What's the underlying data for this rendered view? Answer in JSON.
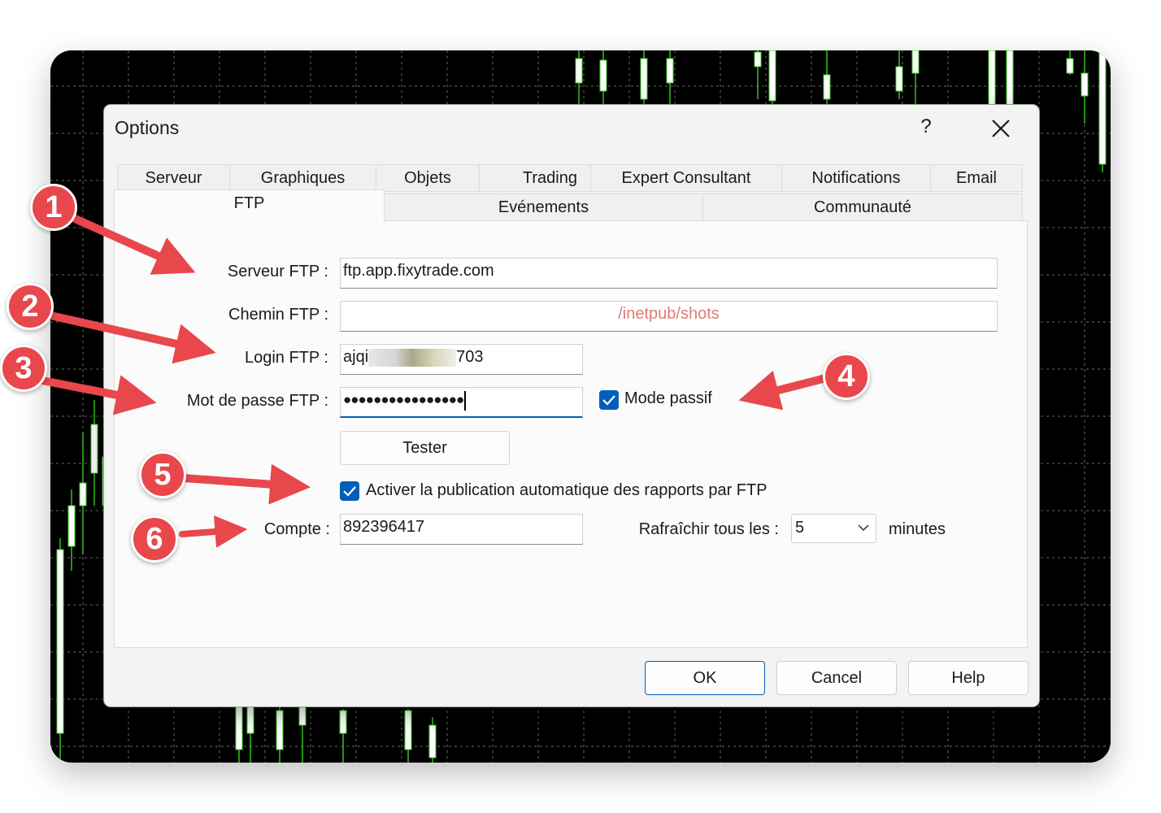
{
  "dialog": {
    "title": "Options",
    "help_label": "?"
  },
  "tabs": {
    "row1": [
      "Serveur",
      "Graphiques",
      "Objets",
      "Trading",
      "Expert Consultant",
      "Notifications",
      "Email"
    ],
    "row2": [
      "FTP",
      "Evénements",
      "Communauté"
    ],
    "active": "FTP"
  },
  "form": {
    "server_label": "Serveur FTP :",
    "server_value": "ftp.app.fixytrade.com",
    "path_label": "Chemin FTP :",
    "path_placeholder": "/inetpub/shots",
    "login_label": "Login FTP :",
    "login_prefix": "ajqi",
    "login_suffix": "703",
    "password_label": "Mot de passe FTP :",
    "password_value": "●●●●●●●●●●●●●●●●",
    "passive_label": "Mode passif",
    "passive_checked": true,
    "test_button": "Tester",
    "autopublish_label": "Activer la publication automatique des rapports par FTP",
    "autopublish_checked": true,
    "account_label": "Compte :",
    "account_value": "892396417",
    "refresh_label": "Rafraîchir tous les :",
    "refresh_value": "5",
    "refresh_unit": "minutes"
  },
  "buttons": {
    "ok": "OK",
    "cancel": "Cancel",
    "help": "Help"
  },
  "annotations": [
    "1",
    "2",
    "3",
    "4",
    "5",
    "6"
  ],
  "colors": {
    "accent": "#005fb8",
    "annotation": "#e8474c",
    "chart_background": "#000000",
    "candle_green": "#37d21e",
    "placeholder": "#e07b78"
  }
}
